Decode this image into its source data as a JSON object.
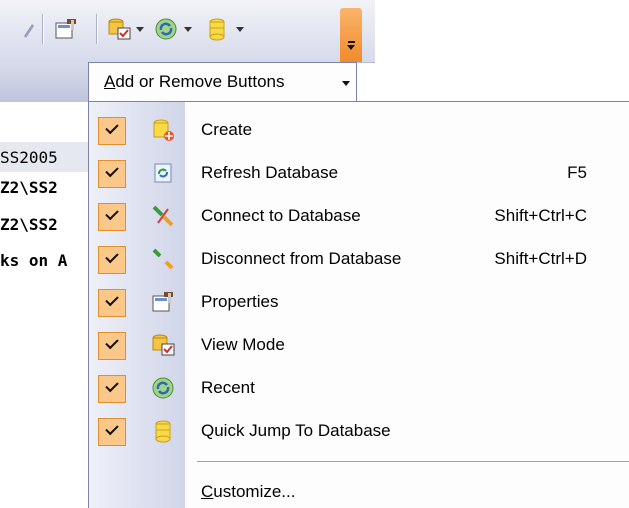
{
  "toolbar": {
    "icons": [
      "properties-icon",
      "view-mode-icon",
      "recent-icon",
      "quick-jump-database-icon"
    ]
  },
  "add_remove": {
    "label": "Add or Remove Buttons",
    "accelerator": "A"
  },
  "background_text": [
    {
      "text": "SS2005",
      "bold": false
    },
    {
      "text": "Z2\\SS2",
      "bold": true
    },
    {
      "text": "Z2\\SS2",
      "bold": true
    },
    {
      "text": "ks on A",
      "bold": true
    }
  ],
  "menu": {
    "items": [
      {
        "label": "Create",
        "shortcut": "",
        "checked": true,
        "icon": "create-database-icon"
      },
      {
        "label": "Refresh Database",
        "shortcut": "F5",
        "checked": true,
        "icon": "refresh-icon"
      },
      {
        "label": "Connect to Database",
        "shortcut": "Shift+Ctrl+C",
        "checked": true,
        "icon": "connect-icon"
      },
      {
        "label": "Disconnect from Database",
        "shortcut": "Shift+Ctrl+D",
        "checked": true,
        "icon": "disconnect-icon"
      },
      {
        "label": "Properties",
        "shortcut": "",
        "checked": true,
        "icon": "properties-icon"
      },
      {
        "label": "View Mode",
        "shortcut": "",
        "checked": true,
        "icon": "view-mode-icon"
      },
      {
        "label": "Recent",
        "shortcut": "",
        "checked": true,
        "icon": "recent-icon"
      },
      {
        "label": "Quick Jump To Database",
        "shortcut": "",
        "checked": true,
        "icon": "quick-jump-database-icon"
      }
    ],
    "customize": "Customize...",
    "customize_accelerator": "C"
  },
  "colors": {
    "check_fill": "#fbc88a",
    "check_border": "#e08f2e",
    "chevron_button": "#f28a2c",
    "menu_border": "#7b84a8"
  }
}
